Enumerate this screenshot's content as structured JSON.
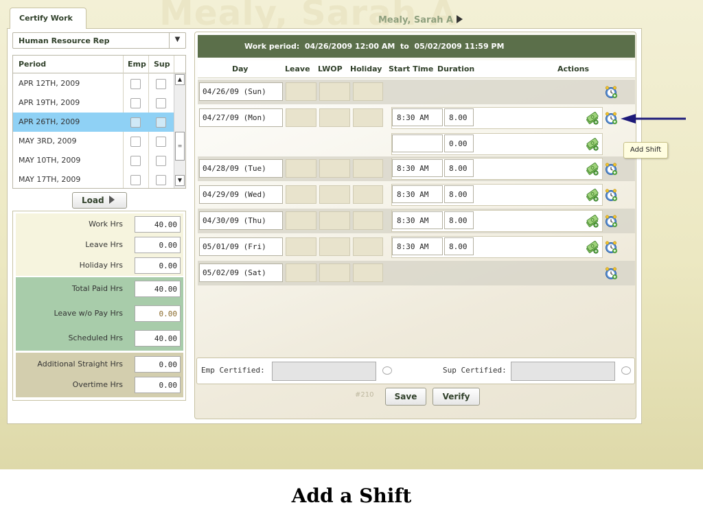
{
  "header": {
    "tab_label": "Certify Work",
    "watermark_name": "Mealy, Sarah A",
    "employee_name": "Mealy, Sarah A"
  },
  "role_select": {
    "value": "Human Resource Rep"
  },
  "periods": {
    "headers": {
      "period": "Period",
      "emp": "Emp",
      "sup": "Sup"
    },
    "rows": [
      {
        "label": "APR 12TH, 2009",
        "selected": false
      },
      {
        "label": "APR 19TH, 2009",
        "selected": false
      },
      {
        "label": "APR 26TH, 2009",
        "selected": true
      },
      {
        "label": "MAY 3RD, 2009",
        "selected": false
      },
      {
        "label": "MAY 10TH, 2009",
        "selected": false
      },
      {
        "label": "MAY 17TH, 2009",
        "selected": false
      }
    ]
  },
  "load_label": "Load",
  "totals": [
    {
      "label": "Work Hrs",
      "value": "40.00"
    },
    {
      "label": "Leave Hrs",
      "value": "0.00"
    },
    {
      "label": "Holiday Hrs",
      "value": "0.00"
    },
    {
      "label": "Total Paid Hrs",
      "value": "40.00"
    },
    {
      "label": "Leave w/o Pay Hrs",
      "value": "0.00"
    },
    {
      "label": "Scheduled Hrs",
      "value": "40.00"
    },
    {
      "label": "Additional Straight Hrs",
      "value": "0.00"
    },
    {
      "label": "Overtime Hrs",
      "value": "0.00"
    }
  ],
  "work_period": {
    "label": "Work period:",
    "start": "04/26/2009 12:00 AM",
    "to": "to",
    "end": "05/02/2009 11:59 PM"
  },
  "grid_headers": {
    "day": "Day",
    "leave": "Leave",
    "lwop": "LWOP",
    "holiday": "Holiday",
    "start_time": "Start Time",
    "duration": "Duration",
    "actions": "Actions"
  },
  "days": [
    {
      "day": "04/26/09 (Sun)",
      "start": "",
      "duration": ""
    },
    {
      "day": "04/27/09 (Mon)",
      "start": "8:30 AM",
      "duration": "8.00"
    },
    {
      "day": "",
      "start": "",
      "duration": "0.00"
    },
    {
      "day": "04/28/09 (Tue)",
      "start": "8:30 AM",
      "duration": "8.00"
    },
    {
      "day": "04/29/09 (Wed)",
      "start": "8:30 AM",
      "duration": "8.00"
    },
    {
      "day": "04/30/09 (Thu)",
      "start": "8:30 AM",
      "duration": "8.00"
    },
    {
      "day": "05/01/09 (Fri)",
      "start": "8:30 AM",
      "duration": "8.00"
    },
    {
      "day": "05/02/09 (Sat)",
      "start": "",
      "duration": ""
    }
  ],
  "tooltip": "Add Shift",
  "certification": {
    "emp_label": "Emp Certified:",
    "sup_label": "Sup Certified:",
    "emp_value": "",
    "sup_value": ""
  },
  "form_id": "#210",
  "buttons": {
    "save": "Save",
    "verify": "Verify"
  },
  "caption": "Add a Shift",
  "colors": {
    "header_bar": "#5b6f4a",
    "selected_row": "#8fd1f5",
    "arrow": "#1d1a7a",
    "paid_group": "#a8ccaa",
    "extra_group": "#d3ceae"
  }
}
